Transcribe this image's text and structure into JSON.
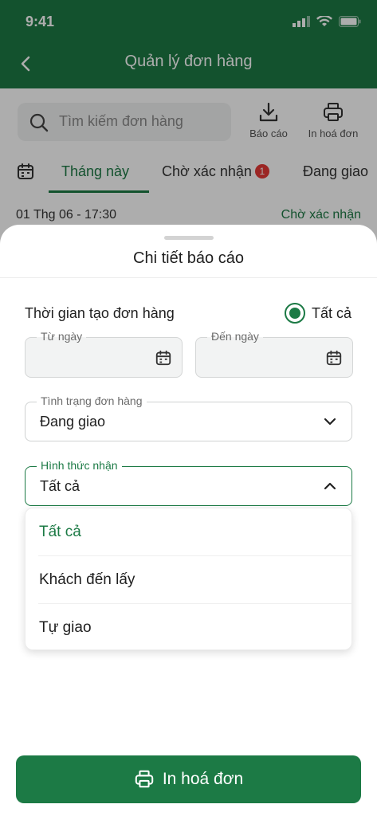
{
  "status_bar": {
    "time": "9:41"
  },
  "header": {
    "title": "Quản lý đơn hàng"
  },
  "toolbar": {
    "search_placeholder": "Tìm kiếm đơn hàng",
    "report_label": "Báo cáo",
    "print_label": "In hoá đơn"
  },
  "tabs": {
    "this_month": "Tháng này",
    "pending": "Chờ xác nhận",
    "pending_count": "1",
    "shipping": "Đang giao"
  },
  "order": {
    "datetime": "01 Thg 06 - 17:30",
    "status": "Chờ xác nhận"
  },
  "sheet": {
    "title": "Chi tiết báo cáo",
    "created_time_label": "Thời gian tạo đơn hàng",
    "all_option": "Tất cả",
    "from_date_label": "Từ ngày",
    "to_date_label": "Đến ngày",
    "order_status_label": "Tình trạng đơn hàng",
    "order_status_value": "Đang giao",
    "receive_method_label": "Hình thức nhận",
    "receive_method_value": "Tất cả",
    "options": [
      "Tất cả",
      "Khách đến lấy",
      "Tự giao"
    ],
    "print_button": "In hoá đơn"
  },
  "colors": {
    "brand_green": "#1c7a45",
    "badge_red": "#e53935"
  }
}
